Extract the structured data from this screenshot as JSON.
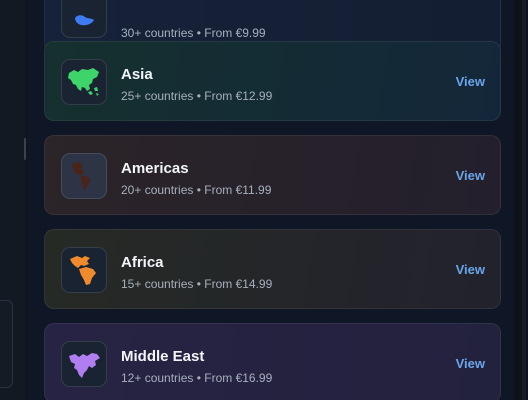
{
  "regions": [
    {
      "name": "",
      "meta": "30+ countries • From €9.99",
      "view_label": "",
      "icon": "globe-europe-icon",
      "color": "#3f7bf3"
    },
    {
      "name": "Asia",
      "meta": "25+ countries • From €12.99",
      "view_label": "View",
      "icon": "asia-map-icon",
      "color": "#3dd46a"
    },
    {
      "name": "Americas",
      "meta": "20+ countries • From €11.99",
      "view_label": "View",
      "icon": "americas-map-icon",
      "color": "#5a2a1c"
    },
    {
      "name": "Africa",
      "meta": "15+ countries • From €14.99",
      "view_label": "View",
      "icon": "africa-map-icon",
      "color": "#f08a2c"
    },
    {
      "name": "Middle East",
      "meta": "12+ countries • From €16.99",
      "view_label": "View",
      "icon": "middle-east-map-icon",
      "color": "#b07ef0"
    }
  ]
}
